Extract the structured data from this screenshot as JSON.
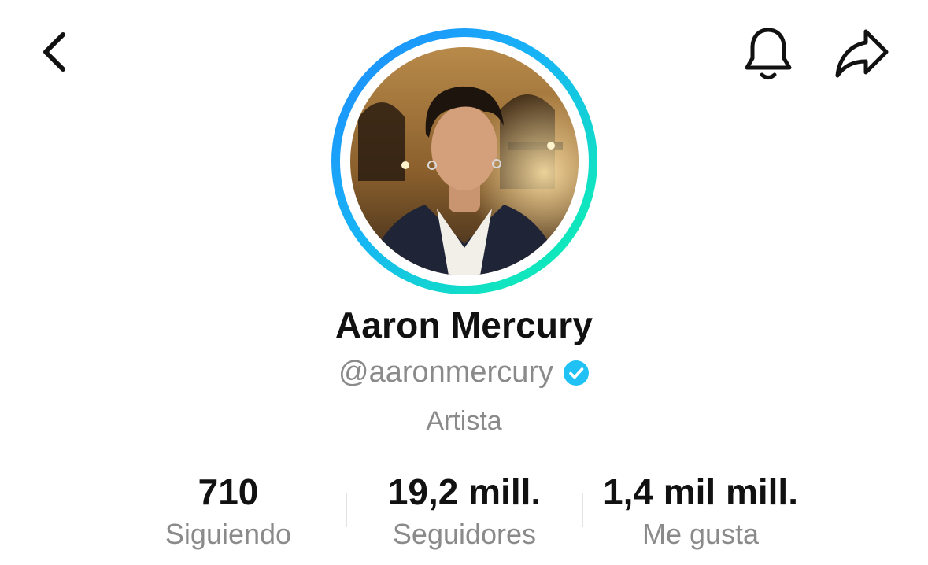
{
  "header": {
    "back_icon": "chevron-left-icon",
    "bell_icon": "bell-icon",
    "share_icon": "share-arrow-icon"
  },
  "profile": {
    "display_name": "Aaron Mercury",
    "username": "@aaronmercury",
    "verified": true,
    "category": "Artista",
    "avatar_ring_colors": [
      "#1e88ff",
      "#12f0b0"
    ],
    "verified_color": "#20c2f5"
  },
  "stats": [
    {
      "value": "710",
      "label": "Siguiendo"
    },
    {
      "value": "19,2 mill.",
      "label": "Seguidores"
    },
    {
      "value": "1,4 mil mill.",
      "label": "Me gusta"
    }
  ]
}
